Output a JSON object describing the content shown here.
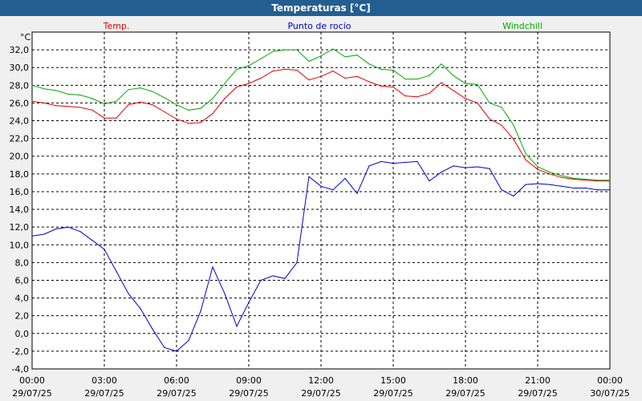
{
  "window": {
    "title": "Temperaturas [°C]"
  },
  "chart_data": {
    "type": "line",
    "title": "Temperaturas [°C]",
    "ylabel": "°C",
    "xlabel": "",
    "ylim": [
      -4,
      34
    ],
    "xlim": [
      0,
      24
    ],
    "x_unit": "hours since 29/07/25 00:00",
    "grid": true,
    "yticks": [
      "-4,0",
      "-2,0",
      "0,0",
      "2,0",
      "4,0",
      "6,0",
      "8,0",
      "10,0",
      "12,0",
      "14,0",
      "16,0",
      "18,0",
      "20,0",
      "22,0",
      "24,0",
      "26,0",
      "28,0",
      "30,0",
      "32,0"
    ],
    "ytick_values": [
      -4,
      -2,
      0,
      2,
      4,
      6,
      8,
      10,
      12,
      14,
      16,
      18,
      20,
      22,
      24,
      26,
      28,
      30,
      32
    ],
    "xticks": [
      {
        "time": "00:00",
        "date": "29/07/25"
      },
      {
        "time": "03:00",
        "date": "29/07/25"
      },
      {
        "time": "06:00",
        "date": "29/07/25"
      },
      {
        "time": "09:00",
        "date": "29/07/25"
      },
      {
        "time": "12:00",
        "date": "29/07/25"
      },
      {
        "time": "15:00",
        "date": "29/07/25"
      },
      {
        "time": "18:00",
        "date": "29/07/25"
      },
      {
        "time": "21:00",
        "date": "29/07/25"
      },
      {
        "time": "00:00",
        "date": "30/07/25"
      }
    ],
    "series": [
      {
        "name": "Temp.",
        "color": "#e00000",
        "points": [
          [
            0,
            26.2
          ],
          [
            0.5,
            26
          ],
          [
            1,
            25.7
          ],
          [
            1.5,
            25.6
          ],
          [
            2,
            25.5
          ],
          [
            2.5,
            25.2
          ],
          [
            3,
            24.3
          ],
          [
            3.5,
            24.3
          ],
          [
            4,
            25.8
          ],
          [
            4.5,
            26.1
          ],
          [
            5,
            25.8
          ],
          [
            5.5,
            25
          ],
          [
            6,
            24.2
          ],
          [
            6.5,
            23.7
          ],
          [
            7,
            23.8
          ],
          [
            7.5,
            24.8
          ],
          [
            8,
            26.5
          ],
          [
            8.5,
            27.8
          ],
          [
            9,
            28.2
          ],
          [
            9.5,
            28.8
          ],
          [
            10,
            29.6
          ],
          [
            10.5,
            29.8
          ],
          [
            11,
            29.7
          ],
          [
            11.5,
            28.6
          ],
          [
            12,
            29
          ],
          [
            12.5,
            29.6
          ],
          [
            13,
            28.8
          ],
          [
            13.5,
            29
          ],
          [
            14,
            28.4
          ],
          [
            14.5,
            27.9
          ],
          [
            15,
            27.8
          ],
          [
            15.5,
            26.8
          ],
          [
            16,
            26.7
          ],
          [
            16.5,
            27.1
          ],
          [
            17,
            28.3
          ],
          [
            17.5,
            27.4
          ],
          [
            18,
            26.5
          ],
          [
            18.5,
            26
          ],
          [
            19,
            24.2
          ],
          [
            19.5,
            23.5
          ],
          [
            20,
            21.9
          ],
          [
            20.5,
            19.6
          ],
          [
            21,
            18.5
          ],
          [
            21.5,
            18
          ],
          [
            22,
            17.6
          ],
          [
            22.5,
            17.4
          ],
          [
            23,
            17.3
          ],
          [
            23.5,
            17.2
          ],
          [
            24,
            17.2
          ]
        ]
      },
      {
        "name": "Punto de rocío",
        "color": "#0000c8",
        "points": [
          [
            0,
            11
          ],
          [
            0.5,
            11.2
          ],
          [
            1,
            11.8
          ],
          [
            1.5,
            12
          ],
          [
            2,
            11.5
          ],
          [
            2.5,
            10.5
          ],
          [
            3,
            9.5
          ],
          [
            3.5,
            7
          ],
          [
            4,
            4.5
          ],
          [
            4.5,
            2.8
          ],
          [
            5,
            0.5
          ],
          [
            5.5,
            -1.6
          ],
          [
            6,
            -2
          ],
          [
            6.5,
            -0.8
          ],
          [
            7,
            2.5
          ],
          [
            7.5,
            7.5
          ],
          [
            8,
            4.5
          ],
          [
            8.5,
            0.8
          ],
          [
            9,
            3.5
          ],
          [
            9.5,
            6
          ],
          [
            10,
            6.5
          ],
          [
            10.5,
            6.2
          ],
          [
            11,
            8
          ],
          [
            11.5,
            17.7
          ],
          [
            12,
            16.6
          ],
          [
            12.5,
            16.2
          ],
          [
            13,
            17.5
          ],
          [
            13.5,
            15.8
          ],
          [
            14,
            18.9
          ],
          [
            14.5,
            19.4
          ],
          [
            15,
            19.2
          ],
          [
            15.5,
            19.3
          ],
          [
            16,
            19.4
          ],
          [
            16.5,
            17.2
          ],
          [
            17,
            18.2
          ],
          [
            17.5,
            18.9
          ],
          [
            18,
            18.7
          ],
          [
            18.5,
            18.8
          ],
          [
            19,
            18.6
          ],
          [
            19.5,
            16.2
          ],
          [
            20,
            15.5
          ],
          [
            20.5,
            16.8
          ],
          [
            21,
            16.9
          ],
          [
            21.5,
            16.8
          ],
          [
            22,
            16.6
          ],
          [
            22.5,
            16.4
          ],
          [
            23,
            16.4
          ],
          [
            23.5,
            16.2
          ],
          [
            24,
            16.2
          ]
        ]
      },
      {
        "name": "Windchill",
        "color": "#00aa00",
        "points": [
          [
            0,
            28
          ],
          [
            0.5,
            27.6
          ],
          [
            1,
            27.4
          ],
          [
            1.5,
            27
          ],
          [
            2,
            26.9
          ],
          [
            2.5,
            26.5
          ],
          [
            3,
            25.9
          ],
          [
            3.5,
            26.2
          ],
          [
            4,
            27.5
          ],
          [
            4.5,
            27.7
          ],
          [
            5,
            27.3
          ],
          [
            5.5,
            26.6
          ],
          [
            6,
            25.8
          ],
          [
            6.5,
            25.2
          ],
          [
            7,
            25.4
          ],
          [
            7.5,
            26.5
          ],
          [
            8,
            28.2
          ],
          [
            8.5,
            29.8
          ],
          [
            9,
            30.2
          ],
          [
            9.5,
            31
          ],
          [
            10,
            31.8
          ],
          [
            10.5,
            32
          ],
          [
            11,
            32
          ],
          [
            11.5,
            30.7
          ],
          [
            12,
            31.3
          ],
          [
            12.5,
            32.1
          ],
          [
            13,
            31.2
          ],
          [
            13.5,
            31.4
          ],
          [
            14,
            30.4
          ],
          [
            14.5,
            29.8
          ],
          [
            15,
            29.7
          ],
          [
            15.5,
            28.7
          ],
          [
            16,
            28.7
          ],
          [
            16.5,
            29.1
          ],
          [
            17,
            30.4
          ],
          [
            17.5,
            29.1
          ],
          [
            18,
            28.2
          ],
          [
            18.5,
            28.1
          ],
          [
            19,
            26
          ],
          [
            19.5,
            25.5
          ],
          [
            20,
            23.5
          ],
          [
            20.5,
            20.3
          ],
          [
            21,
            18.8
          ],
          [
            21.5,
            18.2
          ],
          [
            22,
            17.8
          ],
          [
            22.5,
            17.5
          ],
          [
            23,
            17.4
          ],
          [
            23.5,
            17.3
          ],
          [
            24,
            17.3
          ]
        ]
      }
    ]
  }
}
